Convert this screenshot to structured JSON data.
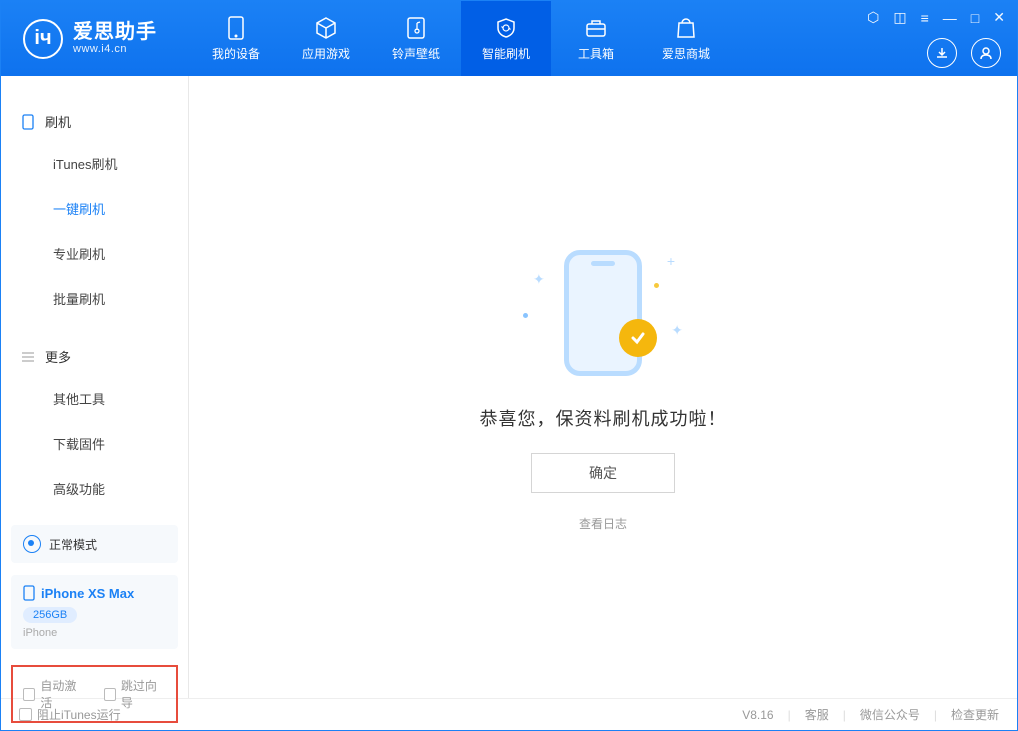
{
  "app": {
    "name": "爱思助手",
    "url": "www.i4.cn"
  },
  "nav": {
    "items": [
      {
        "label": "我的设备"
      },
      {
        "label": "应用游戏"
      },
      {
        "label": "铃声壁纸"
      },
      {
        "label": "智能刷机"
      },
      {
        "label": "工具箱"
      },
      {
        "label": "爱思商城"
      }
    ],
    "active_index": 3
  },
  "sidebar": {
    "flash": {
      "title": "刷机",
      "items": [
        {
          "label": "iTunes刷机"
        },
        {
          "label": "一键刷机"
        },
        {
          "label": "专业刷机"
        },
        {
          "label": "批量刷机"
        }
      ],
      "active_index": 1
    },
    "more": {
      "title": "更多",
      "items": [
        {
          "label": "其他工具"
        },
        {
          "label": "下载固件"
        },
        {
          "label": "高级功能"
        }
      ]
    },
    "mode": {
      "label": "正常模式"
    },
    "device": {
      "name": "iPhone XS Max",
      "storage": "256GB",
      "type": "iPhone"
    },
    "checks": {
      "auto_activate": "自动激活",
      "skip_guide": "跳过向导"
    }
  },
  "main": {
    "success_text": "恭喜您，保资料刷机成功啦！",
    "ok_label": "确定",
    "view_log": "查看日志"
  },
  "status": {
    "block_itunes": "阻止iTunes运行",
    "version": "V8.16",
    "support": "客服",
    "wechat": "微信公众号",
    "update": "检查更新"
  }
}
